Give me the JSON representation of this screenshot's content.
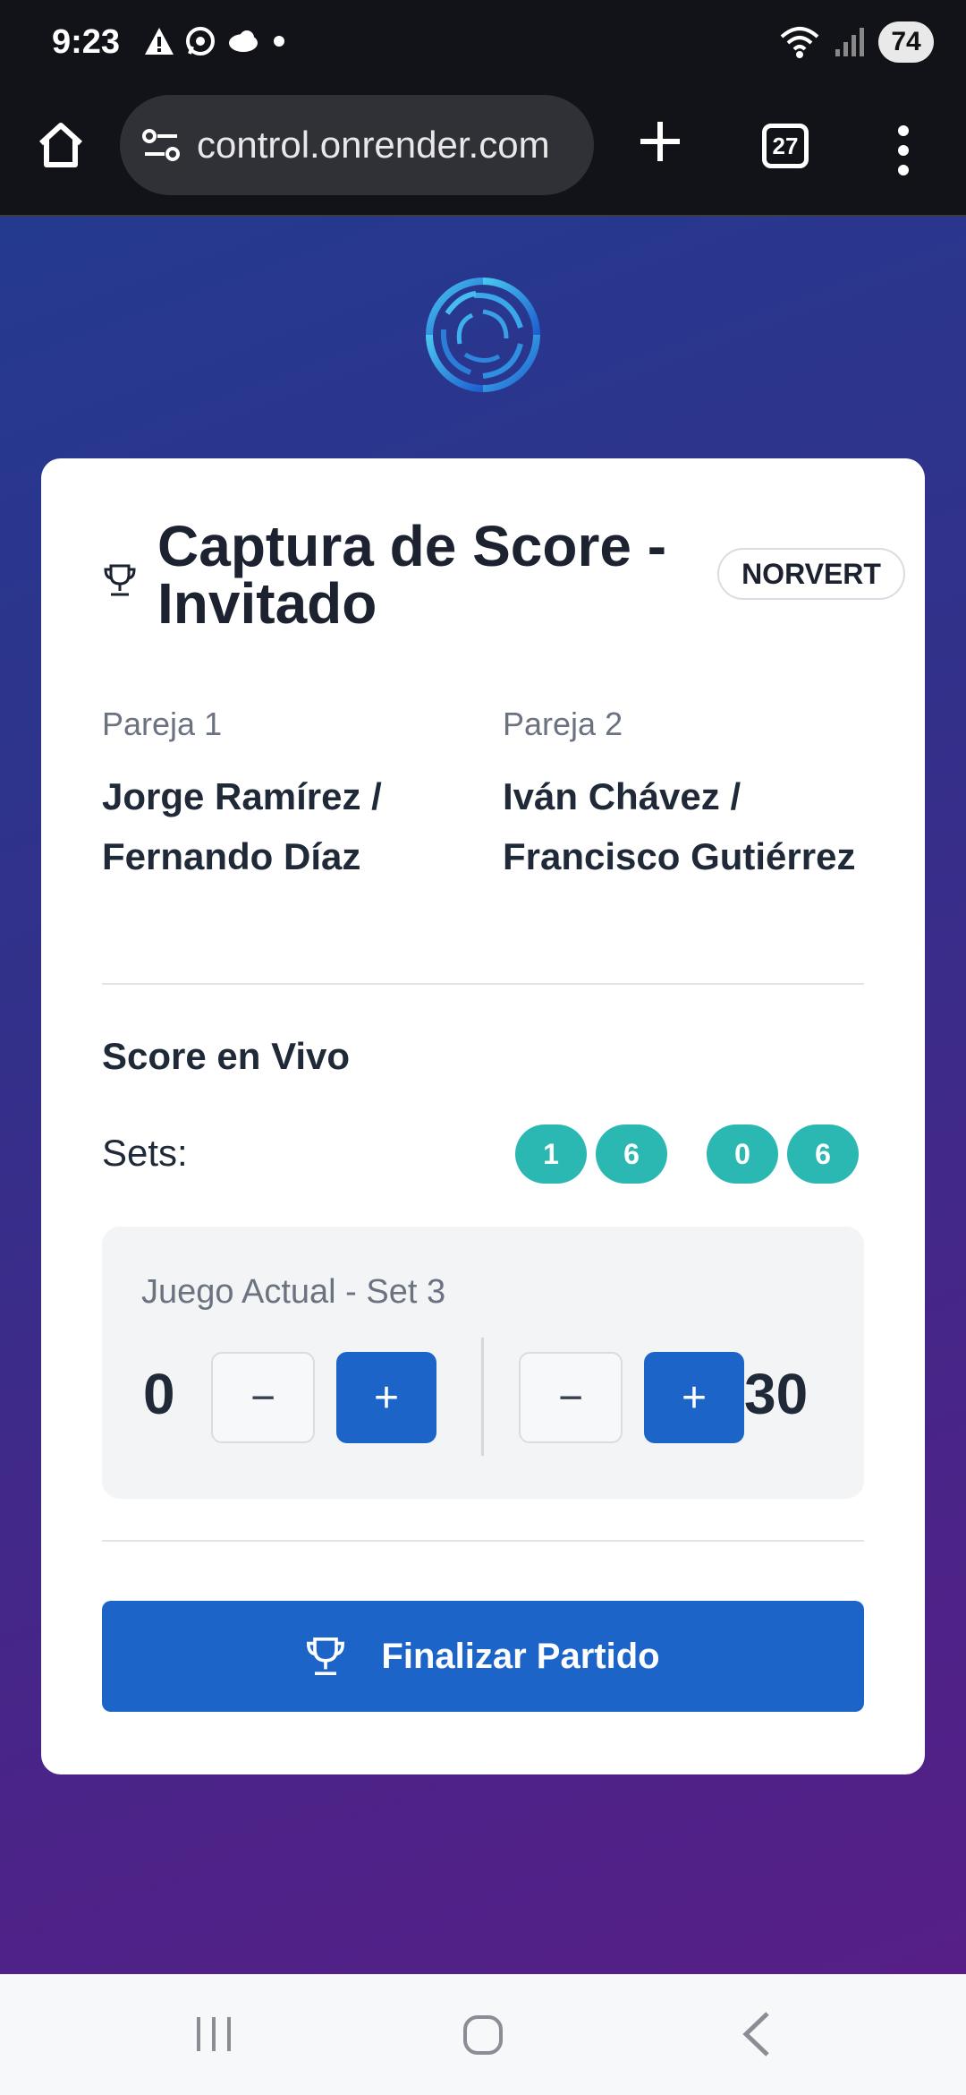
{
  "status_bar": {
    "time": "9:23",
    "battery": "74"
  },
  "browser": {
    "url": "control.onrender.com",
    "tab_count": "27"
  },
  "card": {
    "title": "Captura de Score - Invitado",
    "badge": "NORVERT",
    "pair1": {
      "label": "Pareja 1",
      "names": "Jorge Ramírez / Fernando Díaz"
    },
    "pair2": {
      "label": "Pareja 2",
      "names": "Iván Chávez / Francisco Gutiérrez"
    },
    "section_title": "Score en Vivo",
    "sets_label": "Sets:",
    "sets": {
      "group1": [
        "1",
        "6"
      ],
      "group2": [
        "0",
        "6"
      ]
    },
    "game": {
      "label": "Juego Actual - Set 3",
      "score_left": "0",
      "score_right": "30",
      "minus": "−",
      "plus": "+"
    },
    "finish_button": "Finalizar Partido"
  },
  "colors": {
    "accent_blue": "#1d64c9",
    "set_chip": "#2bb8b2"
  }
}
